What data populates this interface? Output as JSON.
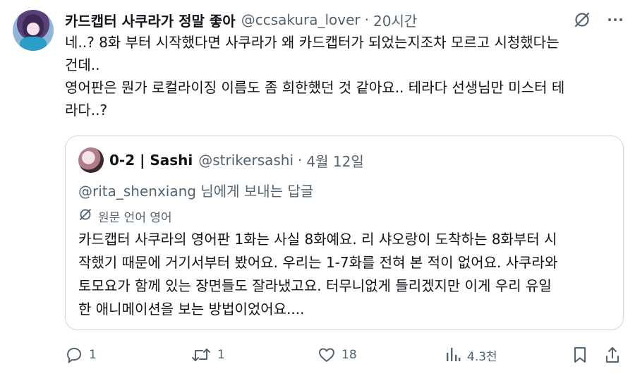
{
  "tweet": {
    "display_name": "카드캡터 사쿠라가 정말 좋아",
    "handle": "@ccsakura_lover",
    "separator": "·",
    "time": "20시간",
    "lines": [
      "네..? 8화 부터 시작했다면 사쿠라가 왜 카드캡터가 되었는지조차 모르고 시청했다는",
      "건데..",
      "영어판은 뭔가 로컬라이징 이름도 좀 희한했던 것 같아요.. 테라다 선생님만 미스터 테",
      "라다..?"
    ]
  },
  "quote": {
    "display_name": "0-2 | Sashi",
    "handle": "@strikersashi",
    "separator": "·",
    "date": "4월 12일",
    "reply_mention": "@rita_shenxiang",
    "reply_suffix": " 님에게 보내는 답글",
    "translate_label": "원문 언어 영어",
    "lines": [
      "카드캡터 사쿠라의 영어판 1화는 사실 8화예요. 리 샤오랑이 도착하는 8화부터 시",
      "작했기 때문에 거기서부터 봤어요. 우리는 1-7화를 전혀 본 적이 없어요. 사쿠라와",
      "토모요가 함께 있는 장면들도 잘라냈고요. 터무니없게 들리겠지만 이게 우리 유일",
      "한 애니메이션을 보는 방법이었어요...."
    ]
  },
  "actions": {
    "reply_count": "1",
    "repost_count": "1",
    "like_count": "18",
    "view_count": "4.3천"
  },
  "icons": {
    "translate": "translate-icon",
    "more": "more-icon",
    "reply": "reply-icon",
    "repost": "repost-icon",
    "like": "like-icon",
    "views": "views-icon",
    "bookmark": "bookmark-icon",
    "share": "share-icon"
  },
  "colors": {
    "text": "#0f1419",
    "secondary": "#536471",
    "border": "#cfd9de"
  }
}
